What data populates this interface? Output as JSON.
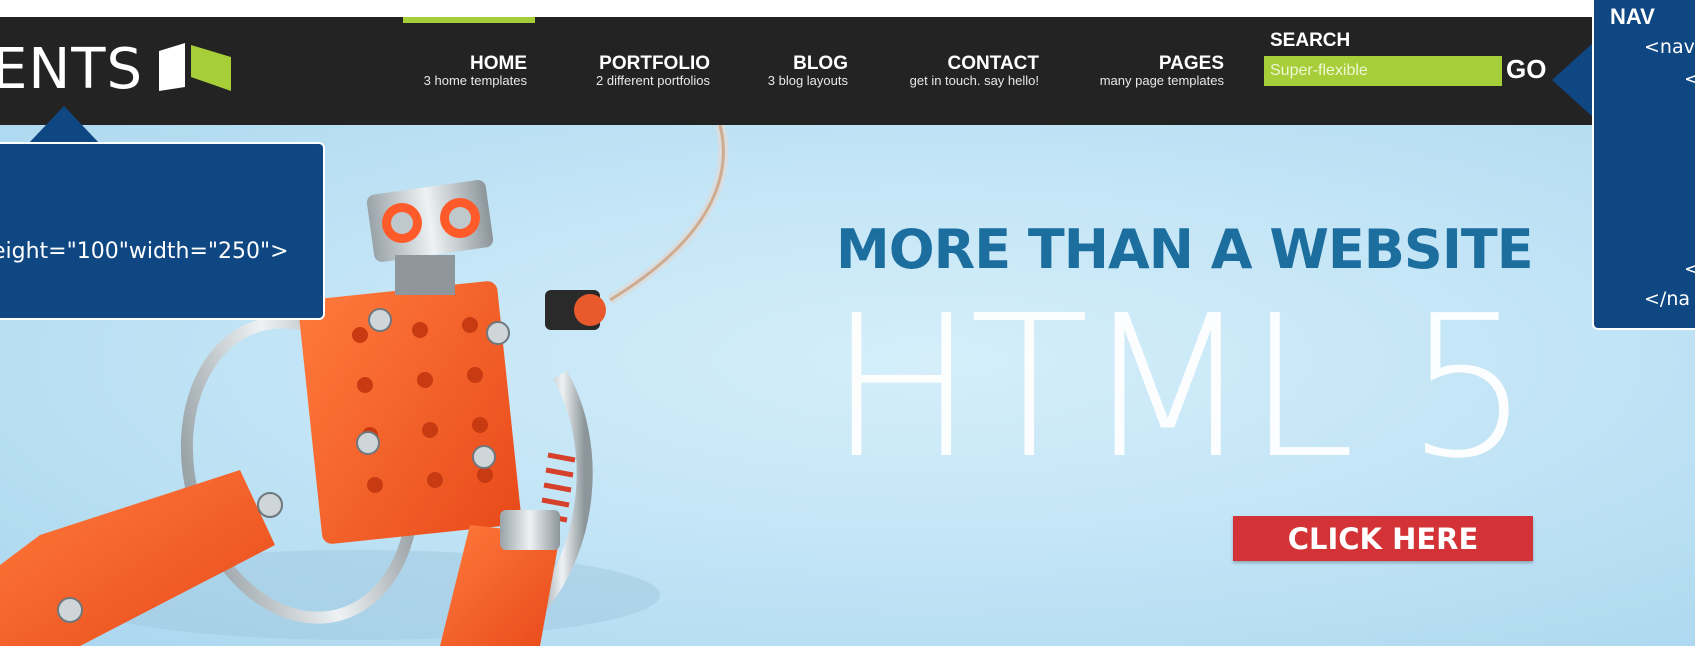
{
  "logo": {
    "text": "ENTS",
    "icon": "logo-icon"
  },
  "nav": {
    "items": [
      {
        "title": "HOME",
        "subtitle": "3 home templates"
      },
      {
        "title": "PORTFOLIO",
        "subtitle": "2 different portfolios"
      },
      {
        "title": "BLOG",
        "subtitle": "3 blog layouts"
      },
      {
        "title": "CONTACT",
        "subtitle": "get in touch. say hello!"
      },
      {
        "title": "PAGES",
        "subtitle": "many page templates"
      }
    ],
    "active_index": 0
  },
  "search": {
    "label": "SEARCH",
    "placeholder": "Super-flexible",
    "value": "",
    "button_label": "GO"
  },
  "hero": {
    "headline": "MORE THAN A WEBSITE",
    "big_text": "HTML 5",
    "cta_label": "CLICK HERE"
  },
  "annotations": {
    "left": {
      "code": "eight=\"100\"width=\"250\">"
    },
    "right": {
      "title": "NAV",
      "line1": "<nav",
      "line2": "<",
      "line3": "<",
      "line4": "</na"
    }
  },
  "colors": {
    "header_bg": "#232323",
    "accent_green": "#a6ce39",
    "headline_blue": "#1c6e9e",
    "cta_red": "#d33236",
    "callout_blue": "#0f4783",
    "hero_sky": "#bfe3f5"
  }
}
